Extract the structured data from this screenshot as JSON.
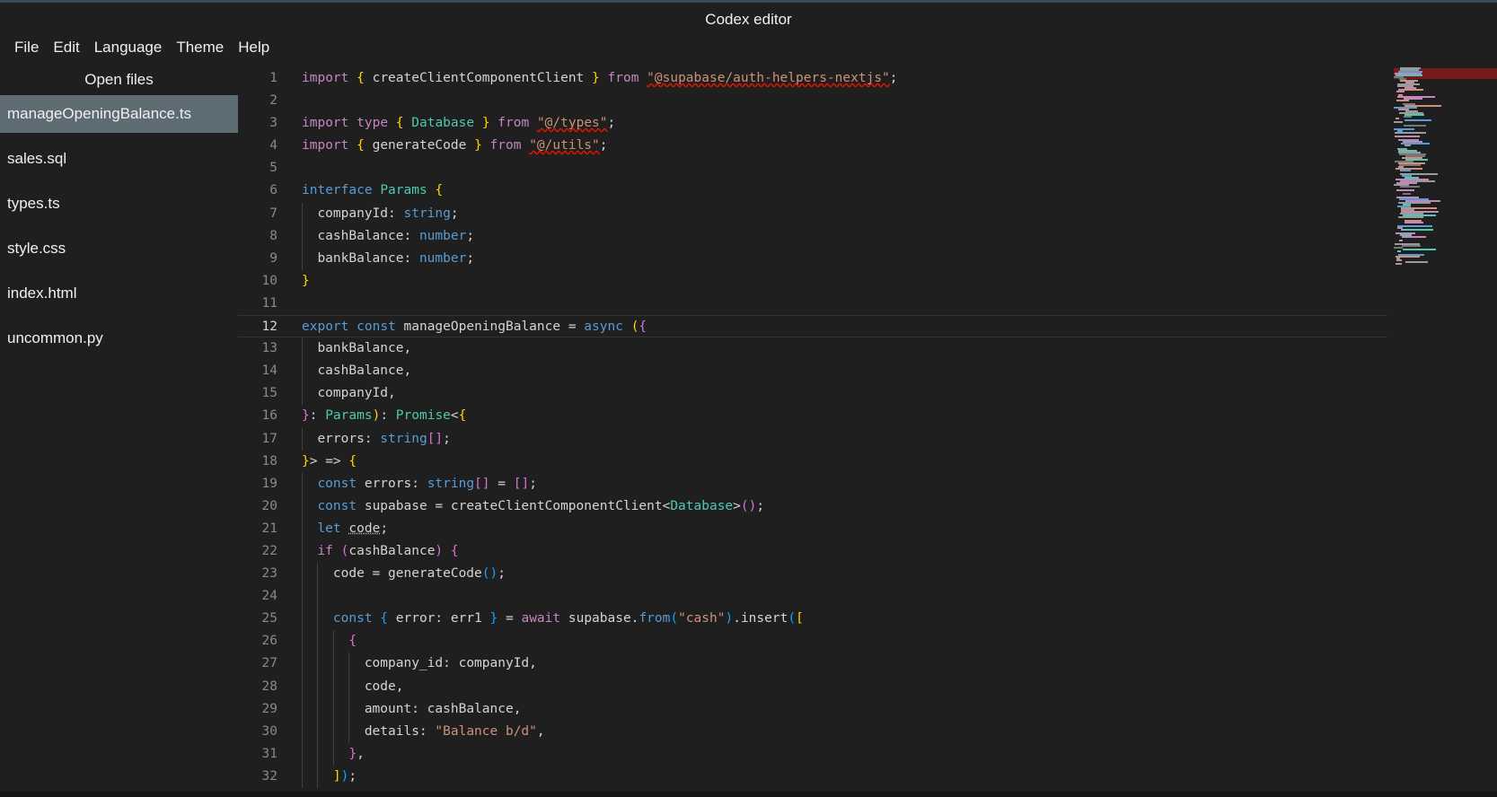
{
  "window": {
    "title": "Codex editor"
  },
  "menu": [
    "File",
    "Edit",
    "Language",
    "Theme",
    "Help"
  ],
  "sidebar": {
    "title": "Open files",
    "files": [
      {
        "name": "manageOpeningBalance.ts",
        "active": true
      },
      {
        "name": "sales.sql"
      },
      {
        "name": "types.ts"
      },
      {
        "name": "style.css"
      },
      {
        "name": "index.html"
      },
      {
        "name": "uncommon.py"
      }
    ]
  },
  "editor": {
    "current_line": 12,
    "lines": [
      {
        "n": "1",
        "tokens": [
          [
            "import",
            "c"
          ],
          [
            " "
          ],
          [
            "{",
            "y"
          ],
          [
            " createClientComponentClient "
          ],
          [
            "}",
            "y"
          ],
          [
            " "
          ],
          [
            "from",
            "c"
          ],
          [
            " "
          ],
          [
            "\"@supabase/auth-helpers-nextjs\"",
            "s err"
          ],
          [
            ";"
          ]
        ]
      },
      {
        "n": "2",
        "tokens": []
      },
      {
        "n": "3",
        "tokens": [
          [
            "import",
            "c"
          ],
          [
            " "
          ],
          [
            "type",
            "c"
          ],
          [
            " "
          ],
          [
            "{",
            "y"
          ],
          [
            " "
          ],
          [
            "Database",
            "t"
          ],
          [
            " "
          ],
          [
            "}",
            "y"
          ],
          [
            " "
          ],
          [
            "from",
            "c"
          ],
          [
            " "
          ],
          [
            "\"@/types\"",
            "s err"
          ],
          [
            ";"
          ]
        ]
      },
      {
        "n": "4",
        "tokens": [
          [
            "import",
            "c"
          ],
          [
            " "
          ],
          [
            "{",
            "y"
          ],
          [
            " generateCode "
          ],
          [
            "}",
            "y"
          ],
          [
            " "
          ],
          [
            "from",
            "c"
          ],
          [
            " "
          ],
          [
            "\"@/utils\"",
            "s err"
          ],
          [
            ";"
          ]
        ]
      },
      {
        "n": "5",
        "tokens": []
      },
      {
        "n": "6",
        "tokens": [
          [
            "interface",
            "k"
          ],
          [
            " "
          ],
          [
            "Params",
            "t"
          ],
          [
            " "
          ],
          [
            "{",
            "y"
          ]
        ]
      },
      {
        "n": "7",
        "indent": 1,
        "tokens": [
          [
            "companyId: "
          ],
          [
            "string",
            "k"
          ],
          [
            ";"
          ]
        ]
      },
      {
        "n": "8",
        "indent": 1,
        "tokens": [
          [
            "cashBalance: "
          ],
          [
            "number",
            "k"
          ],
          [
            ";"
          ]
        ]
      },
      {
        "n": "9",
        "indent": 1,
        "tokens": [
          [
            "bankBalance: "
          ],
          [
            "number",
            "k"
          ],
          [
            ";"
          ]
        ]
      },
      {
        "n": "10",
        "tokens": [
          [
            "}",
            "y"
          ]
        ]
      },
      {
        "n": "11",
        "tokens": []
      },
      {
        "n": "12",
        "tokens": [
          [
            "export",
            "k"
          ],
          [
            " "
          ],
          [
            "const",
            "k"
          ],
          [
            " manageOpeningBalance = "
          ],
          [
            "async",
            "k"
          ],
          [
            " "
          ],
          [
            "(",
            "y"
          ],
          [
            "{",
            "p"
          ]
        ]
      },
      {
        "n": "13",
        "indent": 1,
        "tokens": [
          [
            "bankBalance,"
          ]
        ]
      },
      {
        "n": "14",
        "indent": 1,
        "tokens": [
          [
            "cashBalance,"
          ]
        ]
      },
      {
        "n": "15",
        "indent": 1,
        "tokens": [
          [
            "companyId,"
          ]
        ]
      },
      {
        "n": "16",
        "tokens": [
          [
            "}",
            "p"
          ],
          [
            ": "
          ],
          [
            "Params",
            "t"
          ],
          [
            ")",
            "y"
          ],
          [
            ": "
          ],
          [
            "Promise",
            "t"
          ],
          [
            "<"
          ],
          [
            "{",
            "y"
          ]
        ]
      },
      {
        "n": "17",
        "indent": 1,
        "tokens": [
          [
            "errors: "
          ],
          [
            "string",
            "k"
          ],
          [
            "[]",
            "p"
          ],
          [
            ";"
          ]
        ]
      },
      {
        "n": "18",
        "tokens": [
          [
            "}",
            "y"
          ],
          [
            "> => "
          ],
          [
            "{",
            "y"
          ]
        ]
      },
      {
        "n": "19",
        "indent": 1,
        "tokens": [
          [
            "const",
            "k"
          ],
          [
            " errors: "
          ],
          [
            "string",
            "k"
          ],
          [
            "[]",
            "p"
          ],
          [
            " = "
          ],
          [
            "[]",
            "p"
          ],
          [
            ";"
          ]
        ]
      },
      {
        "n": "20",
        "indent": 1,
        "tokens": [
          [
            "const",
            "k"
          ],
          [
            " supabase = createClientComponentClient<"
          ],
          [
            "Database",
            "t"
          ],
          [
            ">"
          ],
          [
            "()",
            "p"
          ],
          [
            ";"
          ]
        ]
      },
      {
        "n": "21",
        "indent": 1,
        "tokens": [
          [
            "let",
            "k"
          ],
          [
            " "
          ],
          [
            "code",
            "dots"
          ],
          [
            ";"
          ]
        ]
      },
      {
        "n": "22",
        "indent": 1,
        "tokens": [
          [
            "if",
            "c"
          ],
          [
            " "
          ],
          [
            "(",
            "p"
          ],
          [
            "cashBalance"
          ],
          [
            ")",
            "p"
          ],
          [
            " "
          ],
          [
            "{",
            "p"
          ]
        ]
      },
      {
        "n": "23",
        "indent": 2,
        "tokens": [
          [
            "code = generateCode"
          ],
          [
            "()",
            "b"
          ],
          [
            ";"
          ]
        ]
      },
      {
        "n": "24",
        "indent": 2,
        "tokens": []
      },
      {
        "n": "25",
        "indent": 2,
        "tokens": [
          [
            "const",
            "k"
          ],
          [
            " "
          ],
          [
            "{",
            "b"
          ],
          [
            " error: err1 "
          ],
          [
            "}",
            "b"
          ],
          [
            " = "
          ],
          [
            "await",
            "c"
          ],
          [
            " supabase."
          ],
          [
            "from",
            "k"
          ],
          [
            "(",
            "b"
          ],
          [
            "\"cash\"",
            "s"
          ],
          [
            ")",
            "b"
          ],
          [
            ".insert"
          ],
          [
            "(",
            "b"
          ],
          [
            "[",
            "y"
          ]
        ]
      },
      {
        "n": "26",
        "indent": 3,
        "tokens": [
          [
            "{",
            "p"
          ]
        ]
      },
      {
        "n": "27",
        "indent": 4,
        "tokens": [
          [
            "company_id: companyId,"
          ]
        ]
      },
      {
        "n": "28",
        "indent": 4,
        "tokens": [
          [
            "code,"
          ]
        ]
      },
      {
        "n": "29",
        "indent": 4,
        "tokens": [
          [
            "amount: cashBalance,"
          ]
        ]
      },
      {
        "n": "30",
        "indent": 4,
        "tokens": [
          [
            "details: "
          ],
          [
            "\"Balance b/d\"",
            "s"
          ],
          [
            ","
          ]
        ]
      },
      {
        "n": "31",
        "indent": 3,
        "tokens": [
          [
            "}",
            "p"
          ],
          [
            ","
          ]
        ]
      },
      {
        "n": "32",
        "indent": 2,
        "tokens": [
          [
            "]",
            "y"
          ],
          [
            ")",
            "b"
          ],
          [
            ";"
          ]
        ]
      }
    ]
  }
}
